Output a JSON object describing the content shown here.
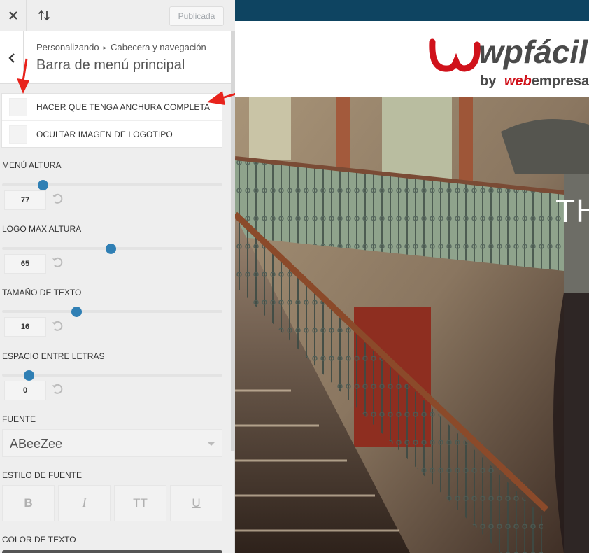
{
  "topbar": {
    "publish_label": "Publicada",
    "close_icon": "close-icon",
    "sort_icon": "sort-arrows-icon"
  },
  "header": {
    "back_icon": "chevron-left-icon",
    "breadcrumb_root": "Personalizando",
    "breadcrumb_parent": "Cabecera y navegación",
    "title": "Barra de menú principal"
  },
  "checkboxes": [
    {
      "label": "HACER QUE TENGA ANCHURA COMPLETA",
      "checked": false
    },
    {
      "label": "OCULTAR IMAGEN DE LOGOTIPO",
      "checked": false
    }
  ],
  "sliders": {
    "menu_height": {
      "label": "MENÚ ALTURA",
      "value": "77"
    },
    "logo_max_height": {
      "label": "LOGO MAX ALTURA",
      "value": "65"
    },
    "text_size": {
      "label": "TAMAÑO DE TEXTO",
      "value": "16"
    },
    "letter_spacing": {
      "label": "ESPACIO ENTRE LETRAS",
      "value": "0"
    }
  },
  "font": {
    "label": "FUENTE",
    "value": "ABeeZee"
  },
  "font_style": {
    "label": "ESTILO DE FUENTE",
    "bold": "B",
    "italic": "I",
    "uppercase": "TT",
    "underline": "U"
  },
  "text_color": {
    "label": "COLOR DE TEXTO"
  },
  "preview": {
    "logo_main": "wpfácil",
    "logo_by": "by",
    "logo_brand_web": "web",
    "logo_brand_rest": "empresa",
    "hero_text": "TH"
  },
  "colors": {
    "accent": "#2f7fb4",
    "top_strip": "#0e4461",
    "logo_red": "#d0121b",
    "logo_gray": "#4a4a4a",
    "annotation_red": "#e8231c"
  }
}
